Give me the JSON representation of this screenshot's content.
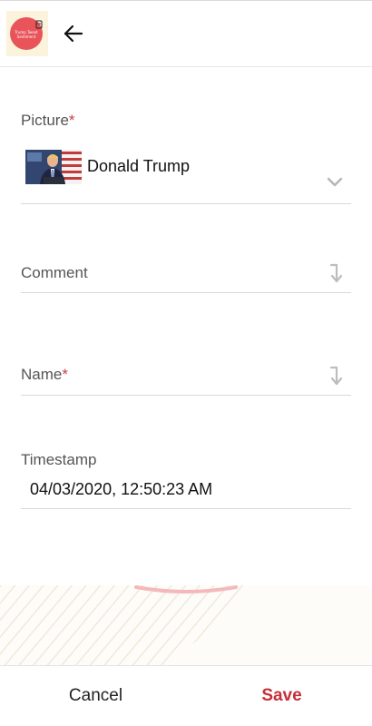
{
  "header": {
    "logo_text": "Trump Tweet Sentiment",
    "back_icon": "arrow-left-icon"
  },
  "form": {
    "picture": {
      "label": "Picture",
      "required_mark": "*",
      "value": "Donald Trump",
      "dropdown_icon": "chevron-down-icon"
    },
    "comment": {
      "label": "Comment",
      "icon": "sort-down-icon"
    },
    "name": {
      "label": "Name",
      "required_mark": "*",
      "icon": "sort-down-icon"
    },
    "timestamp": {
      "label": "Timestamp",
      "value": "04/03/2020, 12:50:23 AM"
    }
  },
  "footer": {
    "cancel_label": "Cancel",
    "save_label": "Save"
  },
  "colors": {
    "accent": "#c62f38",
    "required": "#c8414a",
    "logo_bg": "#e8545a"
  }
}
